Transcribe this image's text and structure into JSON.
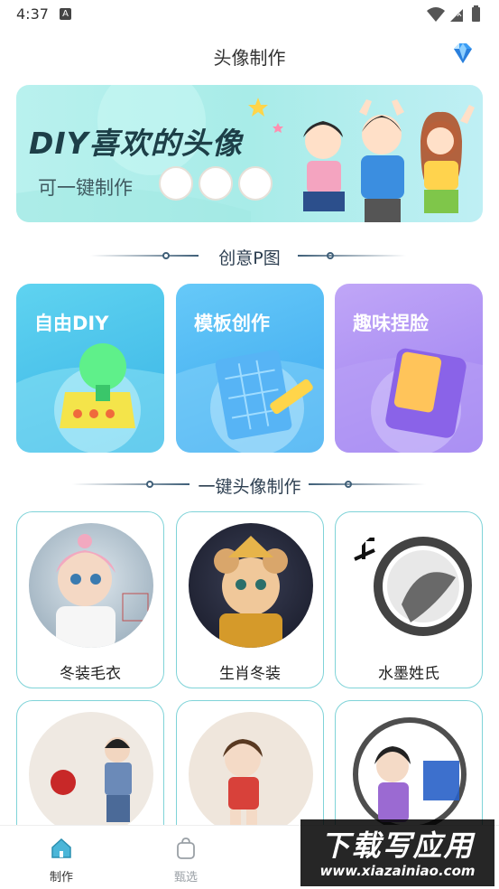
{
  "status_bar": {
    "time": "4:37",
    "notification_badge": "A"
  },
  "header": {
    "title": "头像制作",
    "vip_icon": "diamond-icon"
  },
  "banner": {
    "title": "DIY喜欢的头像",
    "subtitle": "可一键制作"
  },
  "sections": {
    "creative": "创意P图",
    "one_click": "一键头像制作"
  },
  "features": [
    {
      "label": "自由DIY",
      "color": "#4ec3e8"
    },
    {
      "label": "模板创作",
      "color": "#4bb7f5"
    },
    {
      "label": "趣味捏脸",
      "color": "#a98cf0"
    }
  ],
  "templates": [
    {
      "label": "冬装毛衣"
    },
    {
      "label": "生肖冬装"
    },
    {
      "label": "水墨姓氏"
    },
    {
      "label": ""
    },
    {
      "label": ""
    },
    {
      "label": ""
    }
  ],
  "bottom_nav": [
    {
      "label": "制作",
      "active": true,
      "icon": "home-icon",
      "color": "#2aa5c8"
    },
    {
      "label": "甄选",
      "active": false,
      "icon": "bag-icon",
      "color": "#9aa0a6"
    }
  ],
  "watermark": {
    "main": "下载写应用",
    "url": "www.xiazainiao.com"
  }
}
